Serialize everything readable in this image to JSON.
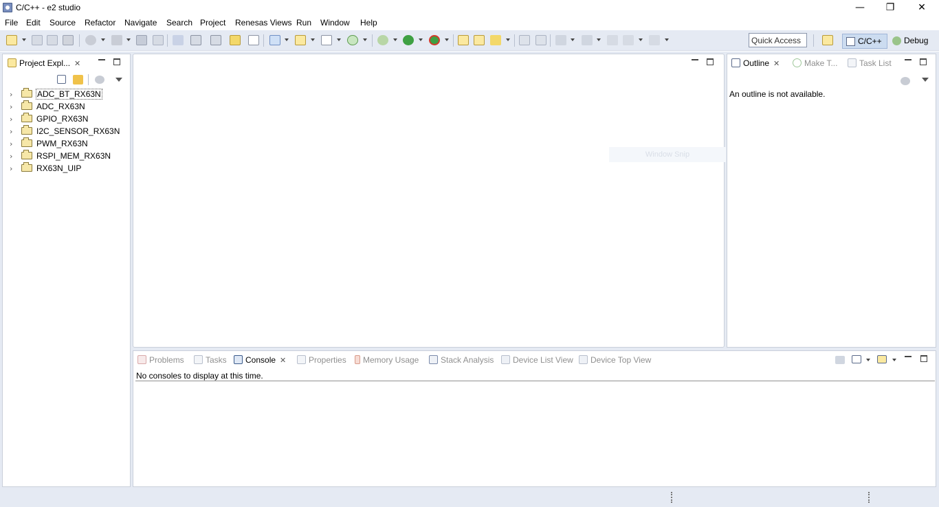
{
  "window": {
    "title": "C/C++ - e2 studio",
    "minimize": "—",
    "maximize": "❐",
    "close": "✕"
  },
  "menu": [
    "File",
    "Edit",
    "Source",
    "Refactor",
    "Navigate",
    "Search",
    "Project",
    "Renesas Views",
    "Run",
    "Window",
    "Help"
  ],
  "toolbar": {
    "quick_access": "Quick Access",
    "perspectives": [
      "C/C++",
      "Debug"
    ]
  },
  "explorer": {
    "tab_label": "Project Expl...",
    "projects": [
      "ADC_BT_RX63N",
      "ADC_RX63N",
      "GPIO_RX63N",
      "I2C_SENSOR_RX63N",
      "PWM_RX63N",
      "RSPI_MEM_RX63N",
      "RX63N_UIP"
    ]
  },
  "outline": {
    "tabs": [
      "Outline",
      "Make T...",
      "Task List"
    ],
    "message": "An outline is not available."
  },
  "bottom": {
    "tabs": [
      "Problems",
      "Tasks",
      "Console",
      "Properties",
      "Memory Usage",
      "Stack Analysis",
      "Device List View",
      "Device Top View"
    ],
    "message": "No consoles to display at this time."
  },
  "overlay": {
    "snip_label": "Window Snip"
  },
  "colors": {
    "chrome_bg": "#e5eaf3",
    "active_perspective": "#ccdcf0",
    "folder": "#f6e7a8"
  }
}
